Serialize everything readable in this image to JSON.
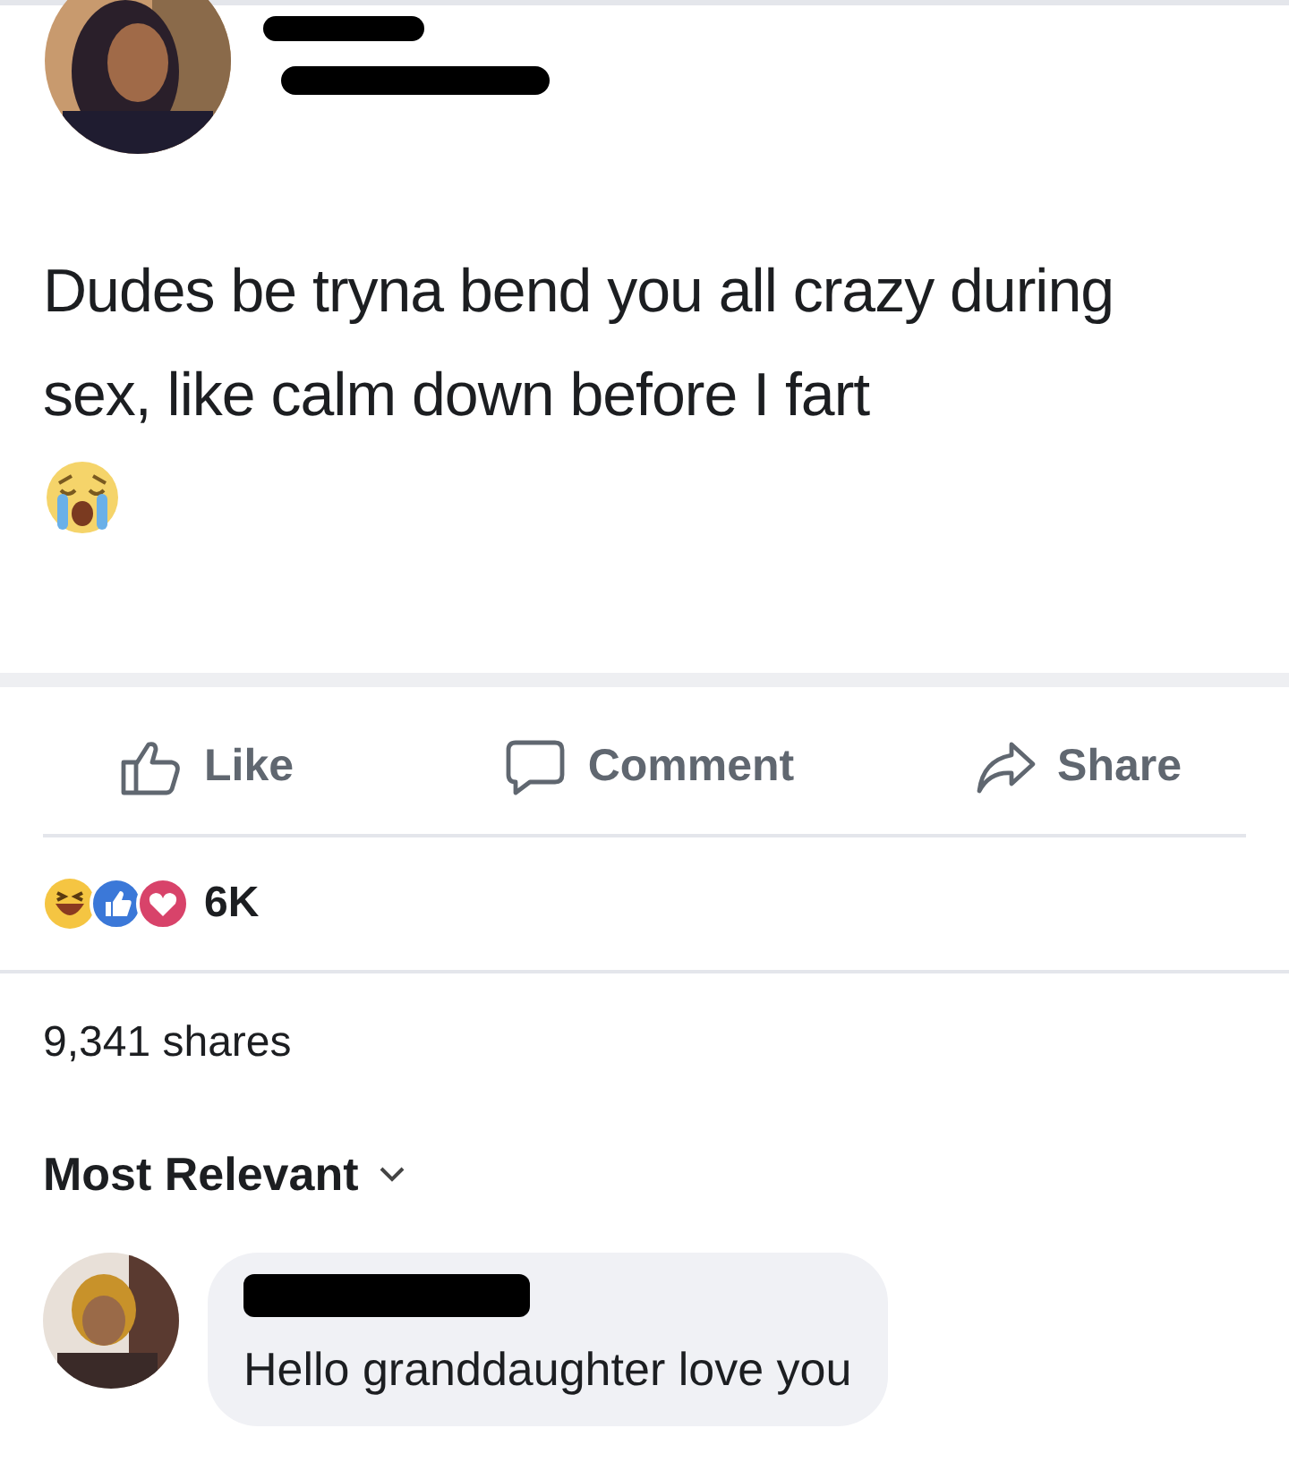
{
  "post": {
    "text": "Dudes be tryna bend you all crazy during sex, like calm down before I fart"
  },
  "actions": [
    {
      "kind": "like",
      "label": "Like"
    },
    {
      "kind": "comment",
      "label": "Comment"
    },
    {
      "kind": "share",
      "label": "Share"
    }
  ],
  "reactions": {
    "count": "6K"
  },
  "shares": "9,341 shares",
  "sort": {
    "label": "Most Relevant"
  },
  "comments": [
    {
      "text": "Hello granddaughter love you"
    }
  ]
}
